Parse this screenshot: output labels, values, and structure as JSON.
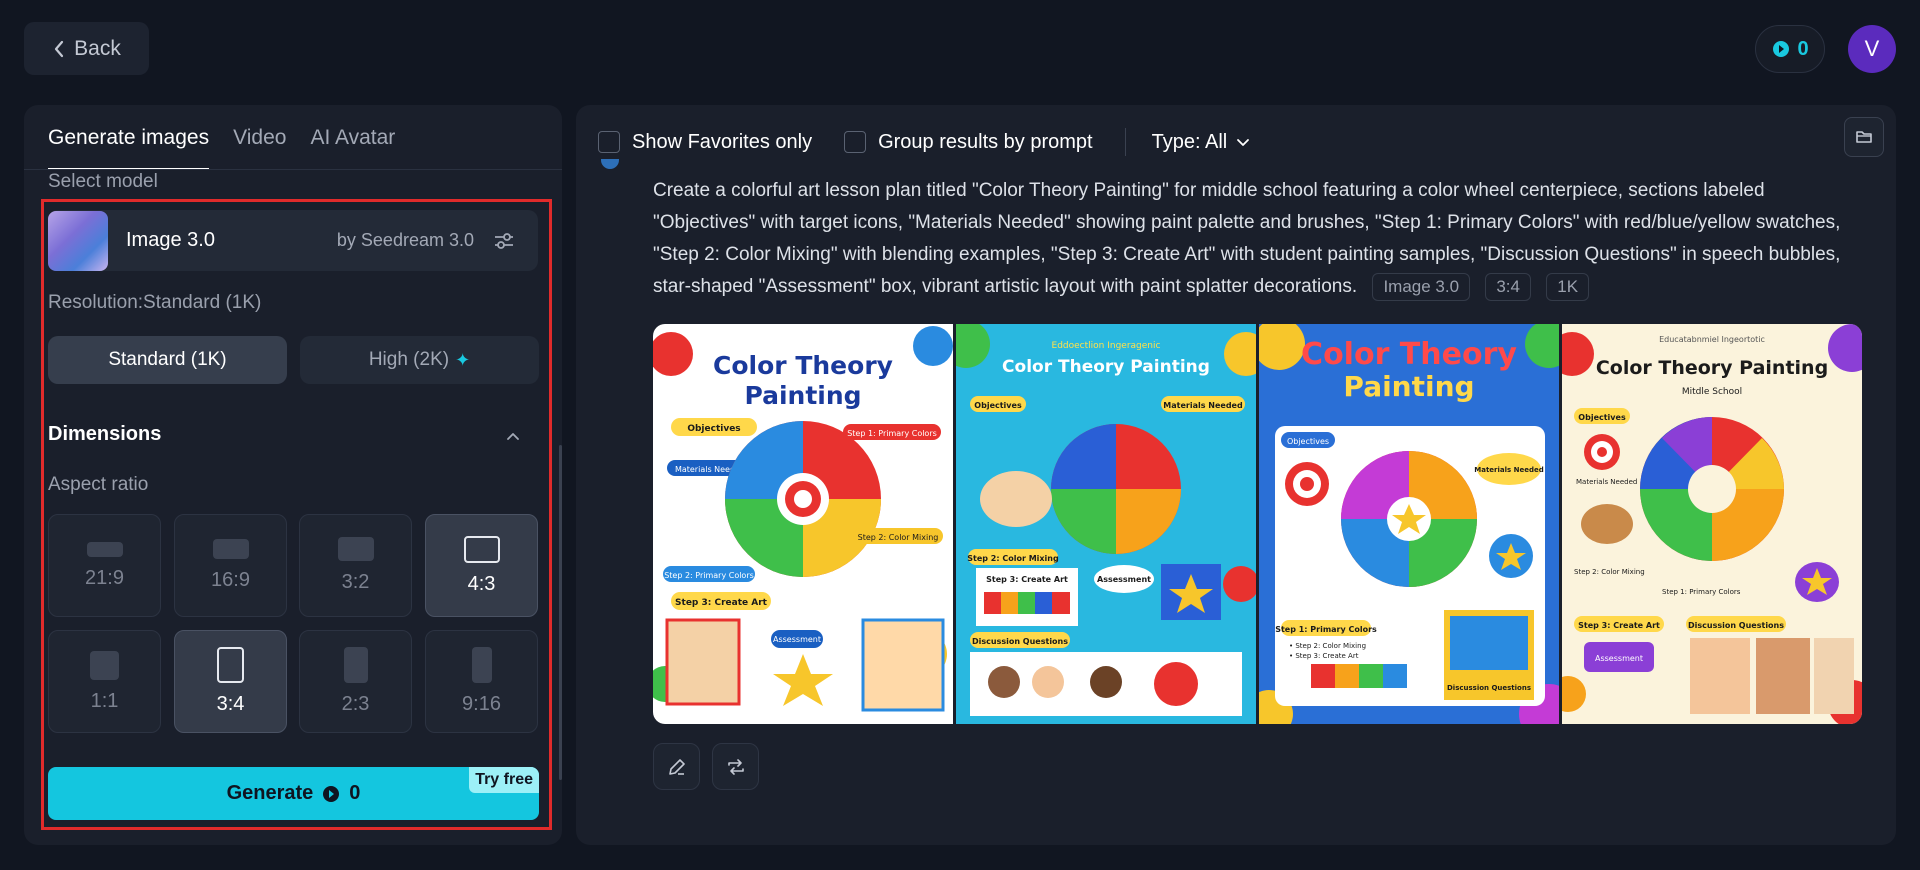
{
  "header": {
    "back_label": "Back",
    "credits": "0",
    "avatar_initial": "V"
  },
  "left_panel": {
    "tabs": [
      {
        "label": "Generate images",
        "active": true
      },
      {
        "label": "Video",
        "active": false
      },
      {
        "label": "AI Avatar",
        "active": false
      }
    ],
    "select_model_label": "Select model",
    "model": {
      "name": "Image 3.0",
      "by": "by Seedream 3.0"
    },
    "resolution_label": "Resolution:Standard (1K)",
    "resolution_options": [
      {
        "label": "Standard (1K)",
        "selected": true
      },
      {
        "label": "High (2K)",
        "selected": false,
        "icon": "sparkle-icon"
      }
    ],
    "dimensions_label": "Dimensions",
    "aspect_ratio_label": "Aspect ratio",
    "aspect_ratios": [
      {
        "label": "21:9",
        "selected": false
      },
      {
        "label": "16:9",
        "selected": false
      },
      {
        "label": "3:2",
        "selected": false
      },
      {
        "label": "4:3",
        "selected": false
      },
      {
        "label": "1:1",
        "selected": false
      },
      {
        "label": "3:4",
        "selected": true
      },
      {
        "label": "2:3",
        "selected": false
      },
      {
        "label": "9:16",
        "selected": false
      }
    ],
    "generate": {
      "label": "Generate",
      "cost": "0",
      "badge": "Try free"
    }
  },
  "right_panel": {
    "show_favorites_label": "Show Favorites only",
    "group_results_label": "Group results by prompt",
    "type_filter_label": "Type: All",
    "prompt_text": "Create a colorful art lesson plan titled \"Color Theory Painting\" for middle school featuring a color wheel centerpiece, sections labeled \"Objectives\" with target icons, \"Materials Needed\" showing paint palette and brushes, \"Step 1: Primary Colors\" with red/blue/yellow swatches, \"Step 2: Color Mixing\" with blending examples, \"Step 3: Create Art\" with student painting samples, \"Discussion Questions\" in speech bubbles, star-shaped \"Assessment\" box, vibrant artistic layout with paint splatter decorations.",
    "tags": [
      "Image 3.0",
      "3:4",
      "1K"
    ],
    "images": [
      {
        "bg": "#ffffff",
        "title_lines": [
          "Color Theory",
          "Painting"
        ],
        "title_color": "#1a3a9c",
        "subtitle": "",
        "labels": [
          "Objectives",
          "Materials Needed",
          "Step 1: Primary Colors",
          "Step 2: Color Mixing",
          "Step 3: Create Art",
          "Assessment"
        ]
      },
      {
        "bg": "#29b8e0",
        "title_lines": [
          "Color Theory Painting"
        ],
        "title_color": "#ffffff",
        "subtitle": "Eddoectlion Ingeragenic",
        "labels": [
          "Objectives",
          "Materials Needed",
          "Step 2: Color Mixing",
          "Step 3: Create Art",
          "Assessment",
          "Discussion Questions"
        ]
      },
      {
        "bg": "#2a6fd6",
        "title_lines": [
          "Color Theory",
          "Painting"
        ],
        "title_color": "#ff4a4a",
        "subtitle": "",
        "labels": [
          "Objectives",
          "Materials Needed",
          "Step 1: Primary Colors",
          "Step 2: Color Mixing",
          "Step 3: Create Art",
          "Discussion Questions"
        ]
      },
      {
        "bg": "#fbf3dc",
        "title_lines": [
          "Color Theory Painting"
        ],
        "title_color": "#1b1b1b",
        "subtitle": "Educatabnmiel Ingeortotic",
        "subtitle2": "Mitdle School",
        "labels": [
          "Objectives",
          "Materials Needed",
          "Step 2: Color Mixing",
          "Step 1: Primary Colors",
          "Step 3: Create Art",
          "Discussion Questions",
          "Assessment"
        ]
      }
    ]
  }
}
